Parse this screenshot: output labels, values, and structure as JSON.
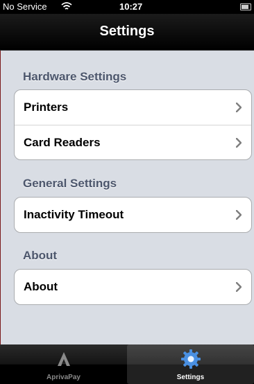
{
  "status_bar": {
    "carrier": "No Service",
    "time": "10:27"
  },
  "nav_bar": {
    "title": "Settings"
  },
  "sections": [
    {
      "header": "Hardware Settings",
      "items": [
        {
          "label": "Printers"
        },
        {
          "label": "Card Readers"
        }
      ]
    },
    {
      "header": "General Settings",
      "items": [
        {
          "label": "Inactivity Timeout"
        }
      ]
    },
    {
      "header": "About",
      "items": [
        {
          "label": "About"
        }
      ]
    }
  ],
  "tab_bar": {
    "tabs": [
      {
        "label": "AprivaPay",
        "icon": "apriva-logo-icon",
        "selected": false
      },
      {
        "label": "Settings",
        "icon": "gear-icon",
        "selected": true
      }
    ]
  },
  "colors": {
    "background": "#d9dde4",
    "section_header": "#4c566c",
    "tab_selected": "#ffffff",
    "tab_unselected": "#8a8a8a",
    "gear_blue": "#4a90e2"
  }
}
